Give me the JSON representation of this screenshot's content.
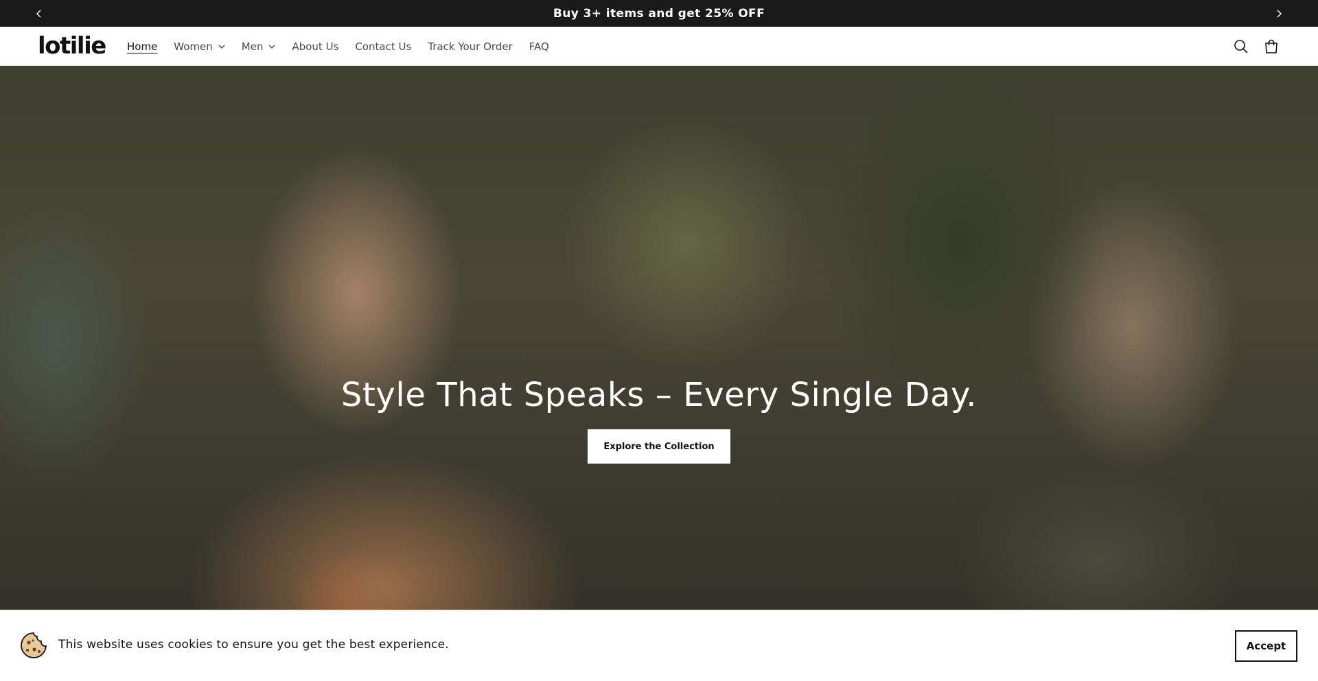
{
  "announcement": {
    "text": "Buy 3+ items and get 25% OFF",
    "prev_icon": "chevron-left-icon",
    "next_icon": "chevron-right-icon"
  },
  "header": {
    "logo": "lotilie",
    "nav": [
      {
        "label": "Home",
        "active": true,
        "dropdown": false
      },
      {
        "label": "Women",
        "active": false,
        "dropdown": true
      },
      {
        "label": "Men",
        "active": false,
        "dropdown": true
      },
      {
        "label": "About Us",
        "active": false,
        "dropdown": false
      },
      {
        "label": "Contact Us",
        "active": false,
        "dropdown": false
      },
      {
        "label": "Track Your Order",
        "active": false,
        "dropdown": false
      },
      {
        "label": "FAQ",
        "active": false,
        "dropdown": false
      }
    ],
    "icons": [
      "search-icon",
      "cart-icon"
    ]
  },
  "hero": {
    "headline": "Style That Speaks – Every Single Day.",
    "cta_label": "Explore the Collection"
  },
  "cookie_banner": {
    "text": "This website uses cookies to ensure you get the best experience.",
    "accept_label": "Accept",
    "icon": "cookie-icon"
  },
  "colors": {
    "announcement_bg": "#1a1a1a",
    "text_primary": "#121212",
    "text_nav": "#4a4a4a",
    "button_bg": "#ffffff"
  }
}
